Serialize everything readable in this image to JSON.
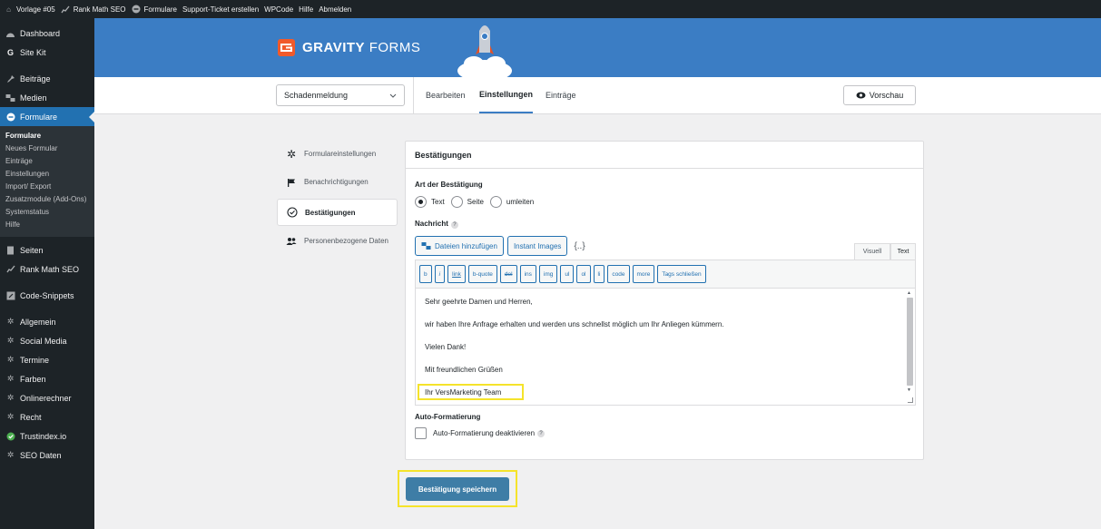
{
  "adminbar": {
    "items": [
      {
        "label": "Vorlage #05",
        "icon": "home-icon"
      },
      {
        "label": "Rank Math SEO",
        "icon": "rank-math-icon"
      },
      {
        "label": "Formulare",
        "icon": "gravity-forms-icon"
      },
      {
        "label": "Support-Ticket erstellen"
      },
      {
        "label": "WPCode"
      },
      {
        "label": "Hilfe"
      },
      {
        "label": "Abmelden"
      }
    ]
  },
  "sidebar": {
    "top_items": [
      {
        "label": "Dashboard",
        "icon": "dashboard-icon"
      },
      {
        "label": "Site Kit",
        "icon": "google-g-icon"
      },
      {
        "label": "Beiträge",
        "icon": "pin-icon"
      },
      {
        "label": "Medien",
        "icon": "media-icon"
      },
      {
        "label": "Formulare",
        "icon": "gravity-forms-icon"
      }
    ],
    "submenu": [
      "Formulare",
      "Neues Formular",
      "Einträge",
      "Einstellungen",
      "Import/ Export",
      "Zusatzmodule (Add-Ons)",
      "Systemstatus",
      "Hilfe"
    ],
    "bottom_items": [
      {
        "label": "Seiten",
        "icon": "page-icon"
      },
      {
        "label": "Rank Math SEO",
        "icon": "rank-math-icon"
      },
      {
        "label": "Code-Snippets",
        "icon": "code-icon"
      },
      {
        "label": "Allgemein",
        "icon": "gear-icon"
      },
      {
        "label": "Social Media",
        "icon": "gear-icon"
      },
      {
        "label": "Termine",
        "icon": "gear-icon"
      },
      {
        "label": "Farben",
        "icon": "gear-icon"
      },
      {
        "label": "Onlinerechner",
        "icon": "gear-icon"
      },
      {
        "label": "Recht",
        "icon": "gear-icon"
      },
      {
        "label": "Trustindex.io",
        "icon": "check-circle-icon"
      },
      {
        "label": "SEO Daten",
        "icon": "gear-icon"
      }
    ]
  },
  "header": {
    "logo_bold": "GRAVITY",
    "logo_light": " FORMS"
  },
  "toolbar": {
    "form_select_value": "Schadenmeldung",
    "tabs": [
      "Bearbeiten",
      "Einstellungen",
      "Einträge"
    ],
    "active_tab": "Einstellungen",
    "preview_label": "Vorschau"
  },
  "settings_nav": {
    "items": [
      {
        "label": "Formulareinstellungen",
        "icon": "gear-icon"
      },
      {
        "label": "Benachrichtigungen",
        "icon": "flag-icon"
      },
      {
        "label": "Bestätigungen",
        "icon": "check-circle-icon"
      },
      {
        "label": "Personenbezogene Daten",
        "icon": "users-icon"
      }
    ]
  },
  "panel": {
    "title": "Bestätigungen",
    "type_label": "Art der Bestätigung",
    "type_options": [
      "Text",
      "Seite",
      "umleiten"
    ],
    "type_selected": "Text",
    "message_label": "Nachricht",
    "help": "?",
    "add_media_label": "Dateien hinzufügen",
    "instant_images_label": "Instant Images",
    "merge_tag": "{..}",
    "editor_tabs": [
      "Visuell",
      "Text"
    ],
    "editor_active_tab": "Text",
    "quicktags": [
      "b",
      "i",
      "link",
      "b-quote",
      "del",
      "ins",
      "img",
      "ul",
      "ol",
      "li",
      "code",
      "more",
      "Tags schließen"
    ],
    "message_lines": [
      "Sehr geehrte Damen und Herren,",
      "wir haben Ihre Anfrage erhalten und werden uns schnellst möglich um Ihr Anliegen kümmern.",
      "Vielen Dank!",
      "Mit freundlichen Grüßen",
      "Ihr VersMarketing Team"
    ],
    "autoformat_label": "Auto-Formatierung",
    "autoformat_checkbox_label": "Auto-Formatierung deaktivieren",
    "autoformat_checked": false
  },
  "save_button_label": "Bestätigung speichern",
  "colors": {
    "wp_blue": "#2271b1",
    "gf_header": "#3b7dc4",
    "gf_orange": "#f15a2b",
    "highlight": "#f5e32b"
  }
}
